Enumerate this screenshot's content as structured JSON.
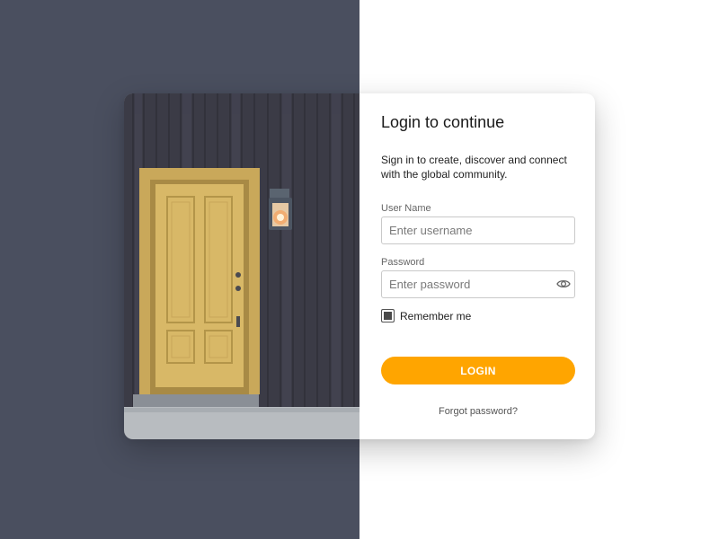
{
  "colors": {
    "background_left": "#4a4f5f",
    "background_right": "#ffffff",
    "accent": "#ffa500"
  },
  "hero_image": {
    "description_icon": "door-photo"
  },
  "login": {
    "title": "Login to continue",
    "subtitle": "Sign in to create, discover and connect with the global community.",
    "username": {
      "label": "User Name",
      "placeholder": "Enter username",
      "value": ""
    },
    "password": {
      "label": "Password",
      "placeholder": "Enter password",
      "value": "",
      "toggle_icon": "eye-icon"
    },
    "remember_label": "Remember me",
    "remember_checked": true,
    "submit_label": "LOGIN",
    "forgot_label": "Forgot password?"
  }
}
